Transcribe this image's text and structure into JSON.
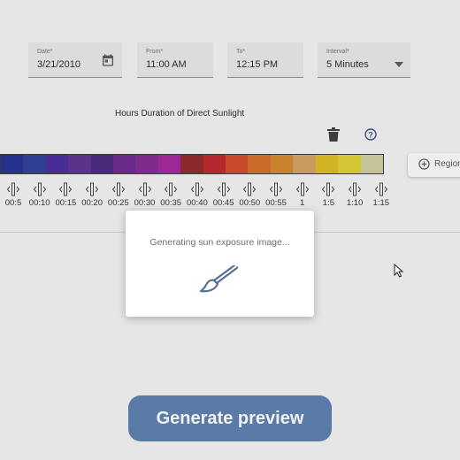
{
  "form": {
    "date": {
      "label": "Date*",
      "value": "3/21/2010",
      "icon": "calendar-icon"
    },
    "from": {
      "label": "From*",
      "value": "11:00 AM"
    },
    "to": {
      "label": "To*",
      "value": "12:15 PM"
    },
    "interval": {
      "label": "Interval*",
      "value": "5 Minutes",
      "icon": "dropdown-arrow-icon"
    }
  },
  "legend": {
    "title": "Hours Duration of Direct Sunlight",
    "delete_icon": "trash-icon",
    "help_icon": "help-circle-icon",
    "region_button": {
      "label": "Region",
      "icon": "plus-circle-icon"
    },
    "swatch_colors": [
      "#25318c",
      "#2e3f94",
      "#4a2c97",
      "#5a3489",
      "#4a2a7a",
      "#6a2a8a",
      "#7e2b8e",
      "#9c2896",
      "#8b2a2c",
      "#b5292c",
      "#c74a2a",
      "#cc6a2a",
      "#c9822e",
      "#c99a5e",
      "#d2b324",
      "#d4c535",
      "#c5c39a"
    ],
    "ticks": [
      "00:5",
      "00:10",
      "00:15",
      "00:20",
      "00:25",
      "00:30",
      "00:35",
      "00:40",
      "00:45",
      "00:50",
      "00:55",
      "1",
      "1:5",
      "1:10",
      "1:15"
    ]
  },
  "modal": {
    "message": "Generating sun exposure image...",
    "icon": "paint-brush-icon"
  },
  "actions": {
    "generate_label": "Generate preview"
  }
}
